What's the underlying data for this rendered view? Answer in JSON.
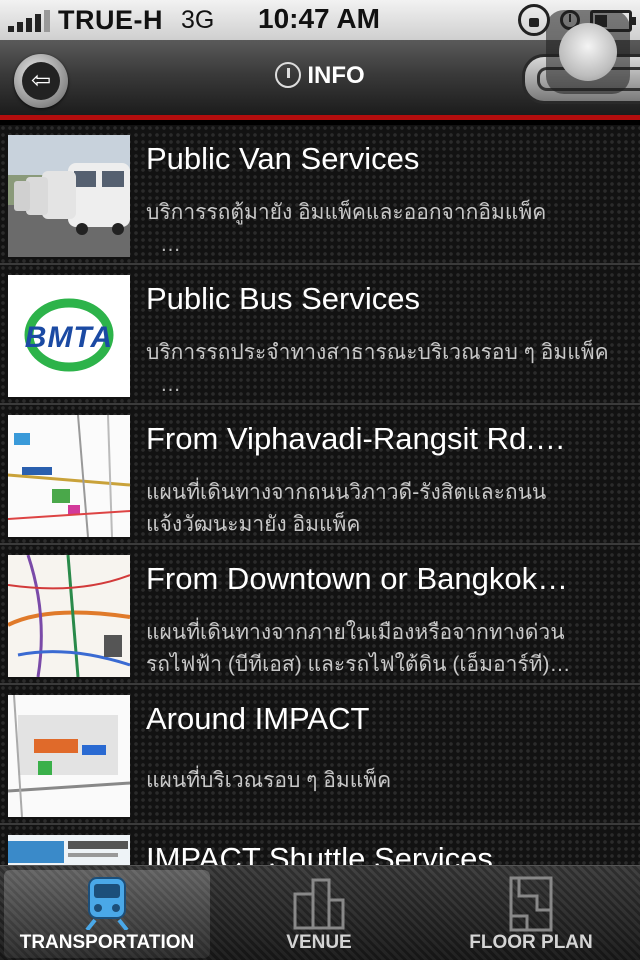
{
  "status_bar": {
    "carrier": "TRUE-H",
    "network": "3G",
    "time": "10:47 AM"
  },
  "nav": {
    "title": "INFO"
  },
  "items": [
    {
      "title": "Public Van Services",
      "description": "บริการรถตู้มายัง อิมแพ็คและออกจากอิมแพ็ค",
      "more": "…"
    },
    {
      "title": "Public Bus Services",
      "description": "บริการรถประจำทางสาธารณะบริเวณรอบ ๆ อิมแพ็ค",
      "more": "…",
      "thumb_text": "BMTA"
    },
    {
      "title": "From Viphavadi-Rangsit Rd.…",
      "description": "แผนที่เดินทางจากถนนวิภาวดี-รังสิตและถนนแจ้งวัฒนะมายัง อิมแพ็ค"
    },
    {
      "title": "From Downtown or Bangkok…",
      "description": "แผนที่เดินทางจากภายในเมืองหรือจากทางด่วนรถไฟฟ้า (บีทีเอส) และรถไฟใต้ดิน (เอ็มอาร์ที)…"
    },
    {
      "title": "Around IMPACT",
      "description": "แผนที่บริเวณรอบ ๆ อิมแพ็ค"
    },
    {
      "title": "IMPACT Shuttle Services",
      "description": ""
    }
  ],
  "tabs": [
    {
      "label": "TRANSPORTATION",
      "icon": "train-icon",
      "active": true
    },
    {
      "label": "VENUE",
      "icon": "buildings-icon",
      "active": false
    },
    {
      "label": "FLOOR PLAN",
      "icon": "floor-plan-icon",
      "active": false
    }
  ],
  "colors": {
    "accent_red": "#b30d0d",
    "active_tab_icon": "#4aa8e8",
    "bmta_blue": "#1b4aa3",
    "bmta_green": "#2db34a"
  }
}
